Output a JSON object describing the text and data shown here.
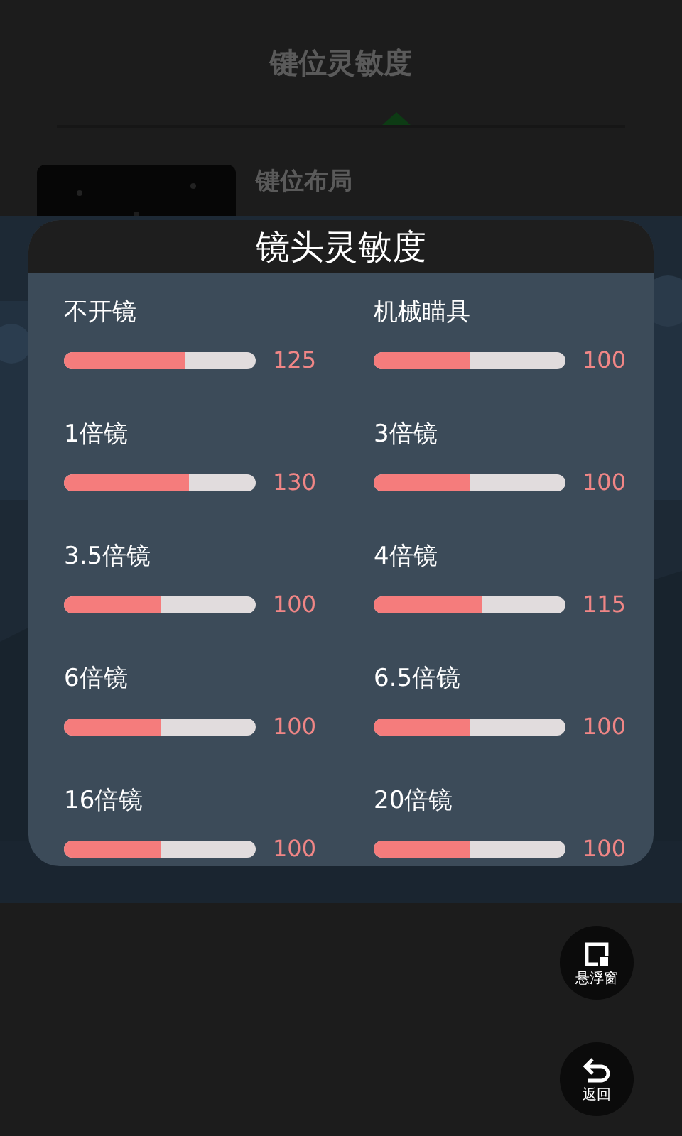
{
  "header": {
    "title": "键位灵敏度"
  },
  "layout_item": {
    "title": "键位布局"
  },
  "dialog": {
    "title": "镜头灵敏度",
    "settings": [
      {
        "label": "不开镜",
        "level": 0.63,
        "reading": "125"
      },
      {
        "label": "机械瞄具",
        "level": 0.5,
        "reading": "100"
      },
      {
        "label": "1倍镜",
        "level": 0.65,
        "reading": "130"
      },
      {
        "label": "3倍镜",
        "level": 0.5,
        "reading": "100"
      },
      {
        "label": "3.5倍镜",
        "level": 0.5,
        "reading": "100"
      },
      {
        "label": "4倍镜",
        "level": 0.56,
        "reading": "115"
      },
      {
        "label": "6倍镜",
        "level": 0.5,
        "reading": "100"
      },
      {
        "label": "6.5倍镜",
        "level": 0.5,
        "reading": "100"
      },
      {
        "label": "16倍镜",
        "level": 0.5,
        "reading": "100"
      },
      {
        "label": "20倍镜",
        "level": 0.5,
        "reading": "100"
      }
    ]
  },
  "floating_buttons": [
    {
      "kind": "float",
      "label": "悬浮窗"
    },
    {
      "kind": "back",
      "label": "返回"
    }
  ]
}
